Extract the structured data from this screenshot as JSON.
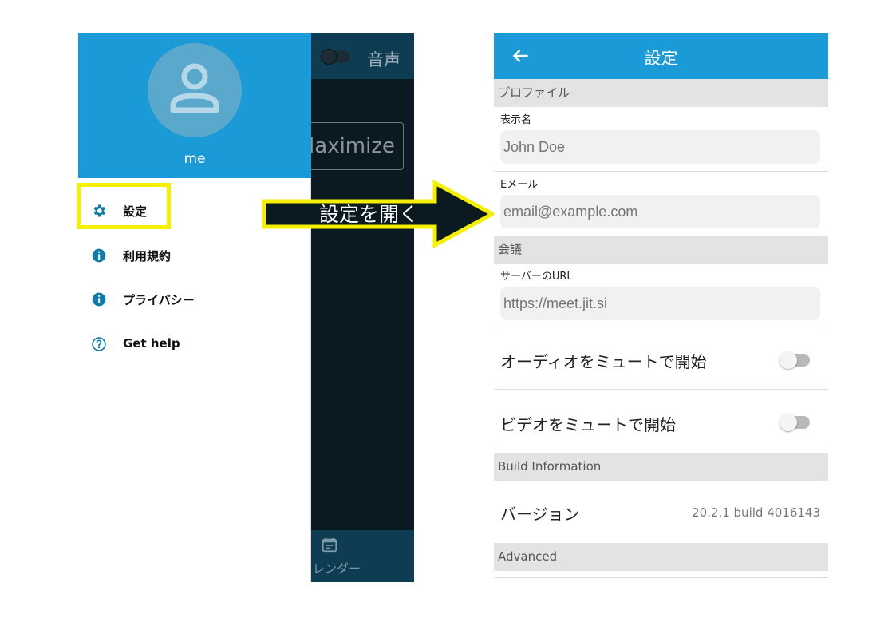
{
  "left_screen": {
    "background": {
      "audio_label": "音声",
      "maximize_label": "Maximize",
      "calendar_label": "レンダー",
      "calendar_icon": "calendar-icon"
    },
    "drawer": {
      "username": "me",
      "avatar_icon": "person-icon",
      "items": [
        {
          "icon": "gear-icon",
          "label": "設定"
        },
        {
          "icon": "info-icon",
          "label": "利用規約"
        },
        {
          "icon": "info-icon",
          "label": "プライバシー"
        },
        {
          "icon": "help-icon",
          "label": "Get help"
        }
      ]
    }
  },
  "annotation": {
    "arrow_label": "設定を開く",
    "highlight_color": "#f5f000"
  },
  "settings": {
    "title": "設定",
    "back_icon": "arrow-left-icon",
    "profile": {
      "section_title": "プロファイル",
      "display_name_label": "表示名",
      "display_name_placeholder": "John Doe",
      "email_label": "Eメール",
      "email_placeholder": "email@example.com"
    },
    "conference": {
      "section_title": "会議",
      "server_url_label": "サーバーのURL",
      "server_url_placeholder": "https://meet.jit.si",
      "start_audio_muted_label": "オーディオをミュートで開始",
      "start_video_muted_label": "ビデオをミュートで開始"
    },
    "build_info": {
      "section_title": "Build Information",
      "version_label": "バージョン",
      "version_value": "20.2.1 build 4016143"
    },
    "advanced": {
      "section_title": "Advanced"
    }
  },
  "colors": {
    "accent": "#1a9ad6",
    "dark_bg": "#0b1a21",
    "dark_bar": "#0e3c52",
    "annotation": "#f5f000"
  }
}
